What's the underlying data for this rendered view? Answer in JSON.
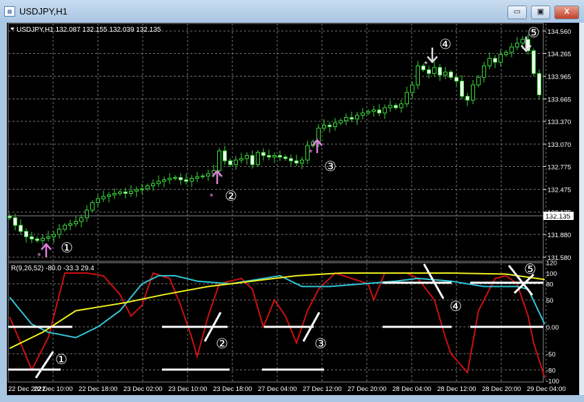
{
  "window": {
    "title": "USDJPY,H1",
    "minimize": "▭",
    "restore": "▣",
    "close": "X"
  },
  "main_panel": {
    "header": "USDJPY,H1  132.087 132.155 132.039 132.135",
    "current_price": "132.135",
    "price_labels": [
      "134.560",
      "134.265",
      "133.965",
      "133.665",
      "133.370",
      "133.070",
      "132.775",
      "132.475",
      "132.175",
      "131.880",
      "131.580"
    ],
    "annotations": [
      "①",
      "②",
      "③",
      "④",
      "⑤"
    ]
  },
  "indicator_panel": {
    "header": "R(9,26,52) -80.0 -33.3 29.4",
    "levels": [
      "120",
      "100",
      "80",
      "50",
      "0.00",
      "-50",
      "-80",
      "-100"
    ],
    "annotations": [
      "①",
      "②",
      "③",
      "④",
      "⑤"
    ]
  },
  "time_labels": [
    "22 Dec 2022",
    "22 Dec 10:00",
    "22 Dec 18:00",
    "23 Dec 02:00",
    "23 Dec 10:00",
    "23 Dec 18:00",
    "27 Dec 04:00",
    "27 Dec 12:00",
    "27 Dec 20:00",
    "28 Dec 04:00",
    "28 Dec 12:00",
    "28 Dec 20:00",
    "29 Dec 04:00"
  ],
  "chart_data": {
    "type": "candlestick",
    "symbol": "USDJPY",
    "timeframe": "H1",
    "ylim": [
      131.58,
      134.56
    ],
    "closes": [
      132.1,
      132.0,
      131.92,
      131.85,
      131.82,
      131.8,
      131.83,
      131.85,
      131.88,
      131.95,
      132.0,
      132.02,
      132.05,
      132.1,
      132.2,
      132.3,
      132.35,
      132.38,
      132.4,
      132.42,
      132.44,
      132.42,
      132.45,
      132.47,
      132.48,
      132.52,
      132.55,
      132.58,
      132.6,
      132.62,
      132.63,
      132.6,
      132.58,
      132.62,
      132.64,
      132.65,
      132.68,
      132.72,
      132.98,
      132.85,
      132.8,
      132.86,
      132.88,
      132.92,
      132.8,
      132.96,
      132.92,
      132.9,
      132.92,
      132.9,
      132.88,
      132.85,
      132.82,
      132.86,
      133.05,
      133.1,
      133.28,
      133.32,
      133.3,
      133.35,
      133.38,
      133.42,
      133.4,
      133.45,
      133.48,
      133.5,
      133.52,
      133.48,
      133.55,
      133.58,
      133.55,
      133.6,
      133.75,
      133.85,
      134.1,
      134.05,
      134.0,
      134.08,
      133.98,
      134.02,
      133.95,
      133.9,
      133.7,
      133.65,
      133.85,
      133.95,
      134.1,
      134.2,
      134.15,
      134.25,
      134.28,
      134.35,
      134.4,
      134.45,
      134.3,
      134.0,
      133.72
    ],
    "oscillator": {
      "ylim": [
        -100,
        120
      ],
      "series": [
        {
          "name": "red",
          "color": "#d01010",
          "points": [
            [
              0,
              18
            ],
            [
              2,
              -30
            ],
            [
              4,
              -80
            ],
            [
              7,
              -20
            ],
            [
              10,
              100
            ],
            [
              14,
              100
            ],
            [
              17,
              95
            ],
            [
              20,
              60
            ],
            [
              22,
              20
            ],
            [
              24,
              40
            ],
            [
              26,
              100
            ],
            [
              29,
              90
            ],
            [
              31,
              40
            ],
            [
              33,
              -20
            ],
            [
              34,
              -55
            ],
            [
              36,
              20
            ],
            [
              38,
              80
            ],
            [
              42,
              90
            ],
            [
              44,
              70
            ],
            [
              46,
              0
            ],
            [
              48,
              50
            ],
            [
              50,
              20
            ],
            [
              52,
              -30
            ],
            [
              54,
              30
            ],
            [
              56,
              70
            ],
            [
              59,
              100
            ],
            [
              62,
              90
            ],
            [
              65,
              80
            ],
            [
              66,
              50
            ],
            [
              68,
              100
            ],
            [
              72,
              100
            ],
            [
              74,
              90
            ],
            [
              77,
              50
            ],
            [
              79,
              -20
            ],
            [
              80,
              -50
            ],
            [
              83,
              -85
            ],
            [
              85,
              30
            ],
            [
              88,
              90
            ],
            [
              90,
              95
            ],
            [
              92,
              80
            ],
            [
              94,
              20
            ],
            [
              95,
              -30
            ],
            [
              97,
              -95
            ]
          ]
        },
        {
          "name": "cyan",
          "color": "#30c8d8",
          "points": [
            [
              0,
              55
            ],
            [
              2,
              30
            ],
            [
              4,
              5
            ],
            [
              7,
              -10
            ],
            [
              12,
              -20
            ],
            [
              16,
              0
            ],
            [
              20,
              30
            ],
            [
              24,
              80
            ],
            [
              27,
              95
            ],
            [
              30,
              95
            ],
            [
              34,
              85
            ],
            [
              40,
              80
            ],
            [
              46,
              90
            ],
            [
              49,
              95
            ],
            [
              53,
              75
            ],
            [
              58,
              75
            ],
            [
              64,
              80
            ],
            [
              70,
              85
            ],
            [
              74,
              90
            ],
            [
              80,
              85
            ],
            [
              86,
              75
            ],
            [
              92,
              75
            ],
            [
              94,
              70
            ],
            [
              97,
              5
            ]
          ]
        },
        {
          "name": "yellow",
          "color": "#f0f020",
          "points": [
            [
              0,
              -40
            ],
            [
              6,
              -10
            ],
            [
              12,
              30
            ],
            [
              18,
              40
            ],
            [
              21,
              45
            ],
            [
              28,
              60
            ],
            [
              36,
              75
            ],
            [
              44,
              85
            ],
            [
              52,
              95
            ],
            [
              60,
              100
            ],
            [
              70,
              100
            ],
            [
              80,
              100
            ],
            [
              90,
              98
            ],
            [
              97,
              88
            ]
          ]
        }
      ]
    }
  }
}
